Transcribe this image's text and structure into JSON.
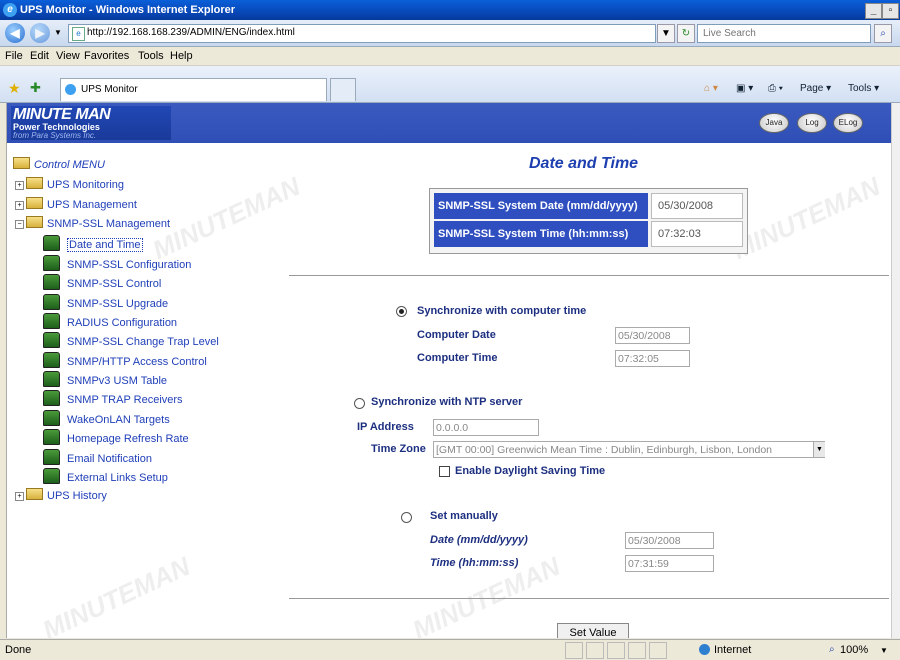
{
  "window": {
    "title": "UPS Monitor - Windows Internet Explorer"
  },
  "browser": {
    "url": "http://192.168.168.239/ADMIN/ENG/index.html",
    "search_placeholder": "Live Search",
    "menus": [
      "File",
      "Edit",
      "View",
      "Favorites",
      "Tools",
      "Help"
    ],
    "tab_title": "UPS Monitor",
    "toolbar": {
      "page": "Page ▾",
      "tools": "Tools ▾"
    }
  },
  "banner": {
    "logo_line1": "MINUTE MAN",
    "logo_line2": "Power Technologies",
    "logo_line3": "from Para Systems Inc.",
    "buttons": [
      "Java",
      "Log",
      "ELog"
    ]
  },
  "tree": {
    "root": "Control MENU",
    "groups": [
      "UPS Monitoring",
      "UPS Management",
      "SNMP-SSL Management"
    ],
    "items": [
      "Date and Time",
      "SNMP-SSL Configuration",
      "SNMP-SSL Control",
      "SNMP-SSL Upgrade",
      "RADIUS Configuration",
      "SNMP-SSL Change Trap Level",
      "SNMP/HTTP Access Control",
      "SNMPv3 USM Table",
      "SNMP TRAP Receivers",
      "WakeOnLAN Targets",
      "Homepage Refresh Rate",
      "Email Notification",
      "External Links Setup"
    ],
    "last_group": "UPS History"
  },
  "content": {
    "title": "Date and Time",
    "sys_date_label": "SNMP-SSL System Date (mm/dd/yyyy)",
    "sys_date": "05/30/2008",
    "sys_time_label": "SNMP-SSL System Time (hh:mm:ss)",
    "sys_time": "07:32:03",
    "sync_pc_label": "Synchronize with computer time",
    "pc_date_label": "Computer Date",
    "pc_date": "05/30/2008",
    "pc_time_label": "Computer Time",
    "pc_time": "07:32:05",
    "ntp_label": "Synchronize with NTP server",
    "ip_label": "IP Address",
    "ip_value": "0.0.0.0",
    "tz_label": "Time Zone",
    "tz_value": "[GMT 00:00] Greenwich Mean Time : Dublin, Edinburgh, Lisbon, London",
    "dst_label": "Enable Daylight Saving Time",
    "manual_label": "Set manually",
    "man_date_label": "Date (mm/dd/yyyy)",
    "man_date": "05/30/2008",
    "man_time_label": "Time (hh:mm:ss)",
    "man_time": "07:31:59",
    "set_button": "Set Value"
  },
  "status": {
    "left": "Done",
    "zone": "Internet",
    "zoom": "100%"
  }
}
